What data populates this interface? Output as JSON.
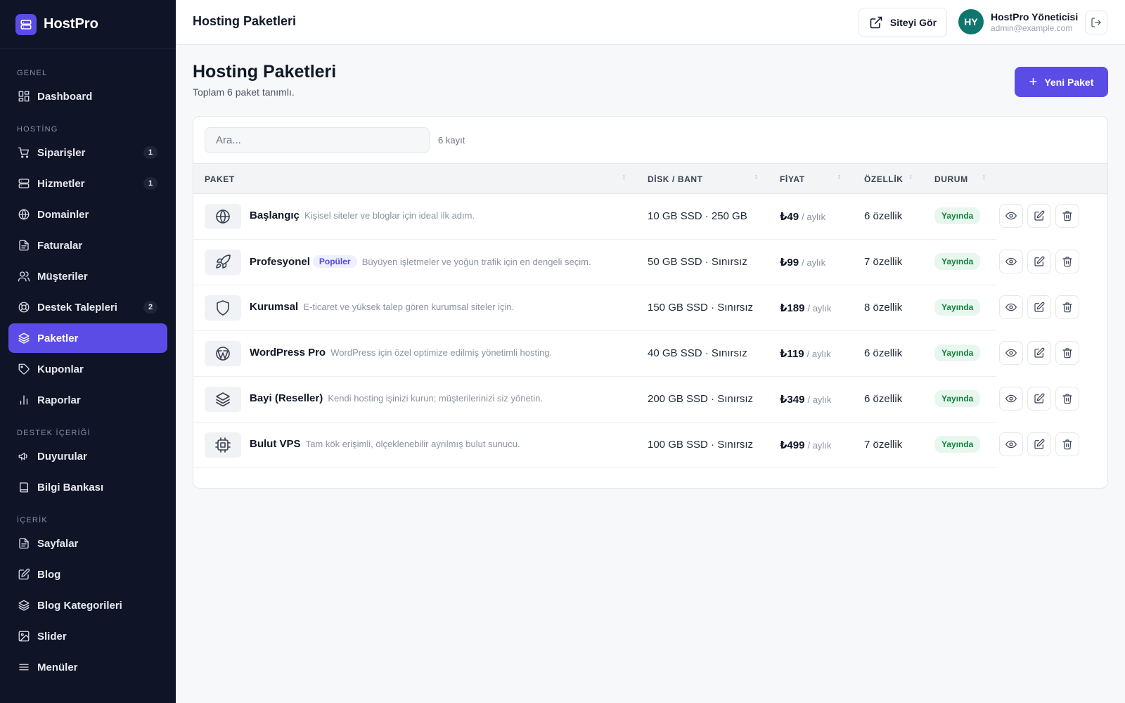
{
  "brand": {
    "name": "HostPro",
    "icon": "server-icon"
  },
  "sidebar": {
    "sections": [
      {
        "label": "GENEL",
        "items": [
          {
            "label": "Dashboard",
            "icon": "grid-icon"
          }
        ]
      },
      {
        "label": "HOSTİNG",
        "items": [
          {
            "label": "Siparişler",
            "icon": "cart-icon",
            "badge": "1"
          },
          {
            "label": "Hizmetler",
            "icon": "server-icon",
            "badge": "1"
          },
          {
            "label": "Domainler",
            "icon": "globe-icon"
          },
          {
            "label": "Faturalar",
            "icon": "file-icon"
          },
          {
            "label": "Müşteriler",
            "icon": "users-icon"
          },
          {
            "label": "Destek Talepleri",
            "icon": "lifebuoy-icon",
            "badge": "2"
          },
          {
            "label": "Paketler",
            "icon": "layers-icon",
            "active": true
          },
          {
            "label": "Kuponlar",
            "icon": "tag-icon"
          },
          {
            "label": "Raporlar",
            "icon": "bar-chart-icon"
          }
        ]
      },
      {
        "label": "DESTEK İÇERİĞİ",
        "items": [
          {
            "label": "Duyurular",
            "icon": "megaphone-icon"
          },
          {
            "label": "Bilgi Bankası",
            "icon": "book-icon"
          }
        ]
      },
      {
        "label": "İÇERİK",
        "items": [
          {
            "label": "Sayfalar",
            "icon": "file-icon"
          },
          {
            "label": "Blog",
            "icon": "edit-icon"
          },
          {
            "label": "Blog Kategorileri",
            "icon": "layers-icon"
          },
          {
            "label": "Slider",
            "icon": "image-icon"
          },
          {
            "label": "Menüler",
            "icon": "menu-icon"
          }
        ]
      }
    ]
  },
  "topbar": {
    "title": "Hosting Paketleri",
    "view_site": "Siteyi Gör",
    "user_initials": "HY",
    "user_name": "HostPro Yöneticisi",
    "user_email": "admin@example.com"
  },
  "page": {
    "title": "Hosting Paketleri",
    "subtitle": "Toplam 6 paket tanımlı.",
    "new_button": "Yeni Paket"
  },
  "table": {
    "search_placeholder": "Ara...",
    "count": "6 kayıt",
    "headers": {
      "paket": "PAKET",
      "disk": "DİSK / BANT",
      "fiyat": "FİYAT",
      "ozellik": "ÖZELLİK",
      "durum": "DURUM"
    },
    "rows": [
      {
        "name": "Başlangıç",
        "desc": "Kişisel siteler ve bloglar için ideal ilk adım.",
        "disk": "10 GB SSD · 250 GB",
        "price": "₺49",
        "period": "/ aylık",
        "features": "6 özellik",
        "status": "Yayında",
        "icon": "globe-icon"
      },
      {
        "name": "Profesyonel",
        "badge": "Popüler",
        "desc": "Büyüyen işletmeler ve yoğun trafik için en dengeli seçim.",
        "disk": "50 GB SSD · Sınırsız",
        "price": "₺99",
        "period": "/ aylık",
        "features": "7 özellik",
        "status": "Yayında",
        "icon": "rocket-icon"
      },
      {
        "name": "Kurumsal",
        "desc": "E-ticaret ve yüksek talep gören kurumsal siteler için.",
        "disk": "150 GB SSD · Sınırsız",
        "price": "₺189",
        "period": "/ aylık",
        "features": "8 özellik",
        "status": "Yayında",
        "icon": "shield-icon"
      },
      {
        "name": "WordPress Pro",
        "desc": "WordPress için özel optimize edilmiş yönetimli hosting.",
        "disk": "40 GB SSD · Sınırsız",
        "price": "₺119",
        "period": "/ aylık",
        "features": "6 özellik",
        "status": "Yayında",
        "icon": "wordpress-icon"
      },
      {
        "name": "Bayi (Reseller)",
        "desc": "Kendi hosting işinizi kurun; müşterilerinizi siz yönetin.",
        "disk": "200 GB SSD · Sınırsız",
        "price": "₺349",
        "period": "/ aylık",
        "features": "6 özellik",
        "status": "Yayında",
        "icon": "layers-icon"
      },
      {
        "name": "Bulut VPS",
        "desc": "Tam kök erişimli, ölçeklenebilir ayrılmış bulut sunucu.",
        "disk": "100 GB SSD · Sınırsız",
        "price": "₺499",
        "period": "/ aylık",
        "features": "7 özellik",
        "status": "Yayında",
        "icon": "cpu-icon"
      }
    ]
  }
}
